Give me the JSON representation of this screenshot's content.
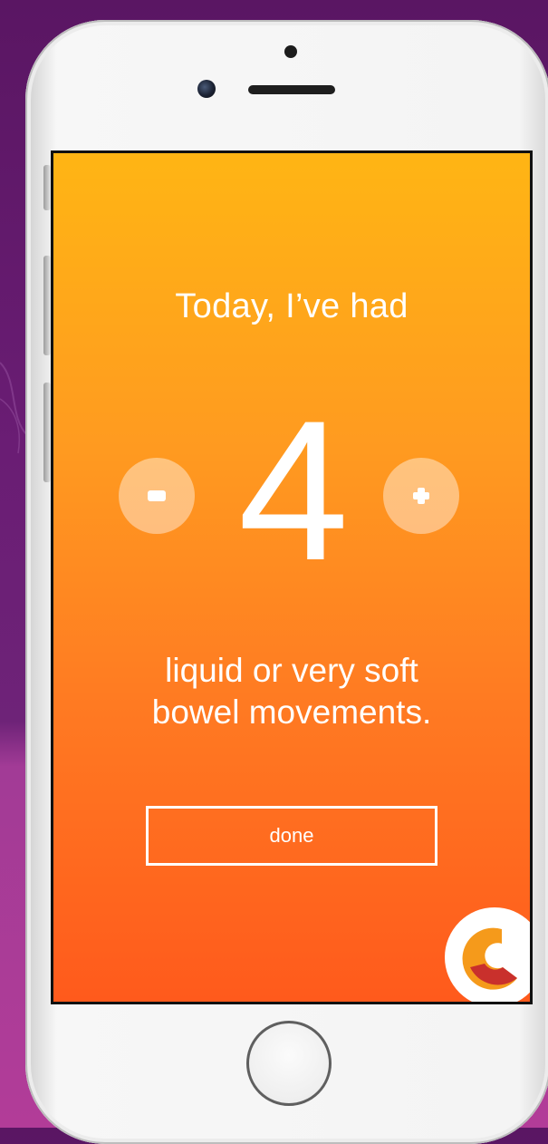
{
  "screen": {
    "headline": "Today, I’ve had",
    "count_value": "4",
    "caption_line1": "liquid or very soft",
    "caption_line2": "bowel movements.",
    "done_label": "done"
  },
  "counter": {
    "decrement_icon": "minus-icon",
    "increment_icon": "plus-icon"
  },
  "colors": {
    "gradient_top": "#ffb514",
    "gradient_bottom": "#ff5a1c",
    "logo_orange": "#f59a1b",
    "logo_red": "#c9302c",
    "background_purple": "#6a1d74"
  }
}
